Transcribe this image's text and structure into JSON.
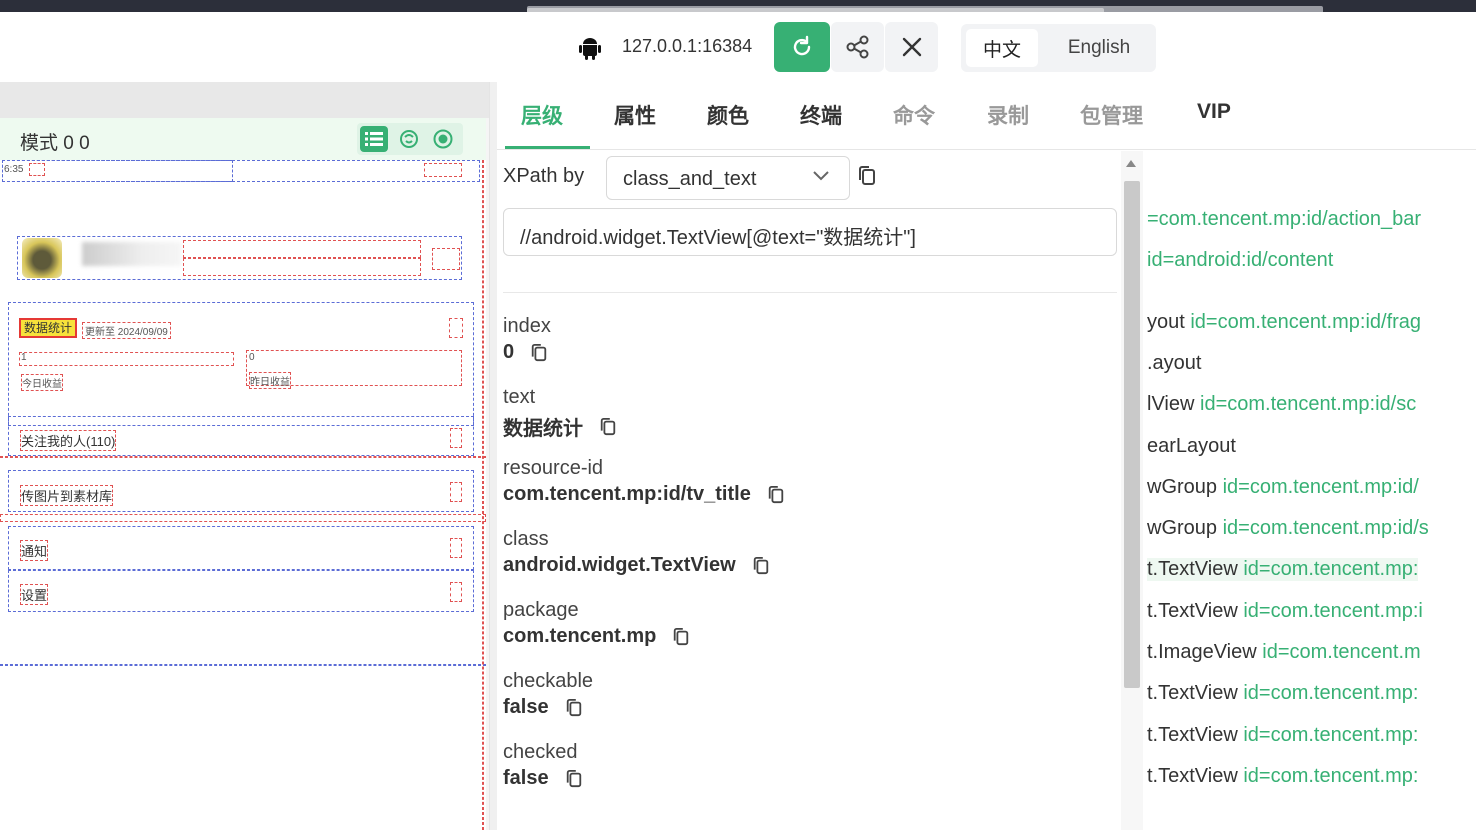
{
  "toolbar": {
    "device_address": "127.0.0.1:16384",
    "icons": [
      "android-icon",
      "refresh-icon",
      "share-icon",
      "close-icon"
    ],
    "lang_zh": "中文",
    "lang_en": "English"
  },
  "device": {
    "mode_label": "模式 0 0",
    "status_time": "6:35",
    "title_text": "数据统计",
    "date_text": "更新至 2024/09/09",
    "stat_left_value": "1",
    "stat_left_label": "今日收益",
    "stat_right_value": "0",
    "stat_right_label": "昨日收益",
    "rows": [
      "关注我的人(110)",
      "传图片到素材库",
      "通知",
      "设置"
    ]
  },
  "tabs": [
    "层级",
    "属性",
    "颜色",
    "终端",
    "命令",
    "录制",
    "包管理",
    "VIP"
  ],
  "xpath": {
    "label": "XPath by",
    "strategy": "class_and_text",
    "expression": "//android.widget.TextView[@text=\"数据统计\"]"
  },
  "properties": [
    {
      "key": "index",
      "value": "0"
    },
    {
      "key": "text",
      "value": "数据统计"
    },
    {
      "key": "resource-id",
      "value": "com.tencent.mp:id/tv_title"
    },
    {
      "key": "class",
      "value": "android.widget.TextView"
    },
    {
      "key": "package",
      "value": "com.tencent.mp"
    },
    {
      "key": "checkable",
      "value": "false"
    },
    {
      "key": "checked",
      "value": "false"
    }
  ],
  "tree": [
    {
      "prefix": "",
      "rid": "=com.tencent.mp:id/action_bar"
    },
    {
      "prefix": "",
      "rid": " id=android:id/content"
    },
    {
      "prefix": "yout ",
      "rid": "id=com.tencent.mp:id/frag"
    },
    {
      "prefix": ".ayout",
      "rid": ""
    },
    {
      "prefix": "lView ",
      "rid": "id=com.tencent.mp:id/sc"
    },
    {
      "prefix": "earLayout",
      "rid": ""
    },
    {
      "prefix": "wGroup ",
      "rid": "id=com.tencent.mp:id/"
    },
    {
      "prefix": "wGroup ",
      "rid": "id=com.tencent.mp:id/s"
    },
    {
      "prefix": "t.TextView ",
      "rid": "id=com.tencent.mp:"
    },
    {
      "prefix": "t.TextView ",
      "rid": "id=com.tencent.mp:i"
    },
    {
      "prefix": "t.ImageView ",
      "rid": "id=com.tencent.m"
    },
    {
      "prefix": "t.TextView ",
      "rid": "id=com.tencent.mp:"
    },
    {
      "prefix": "t.TextView ",
      "rid": "id=com.tencent.mp:"
    },
    {
      "prefix": "t.TextView ",
      "rid": "id=com.tencent.mp:"
    }
  ]
}
